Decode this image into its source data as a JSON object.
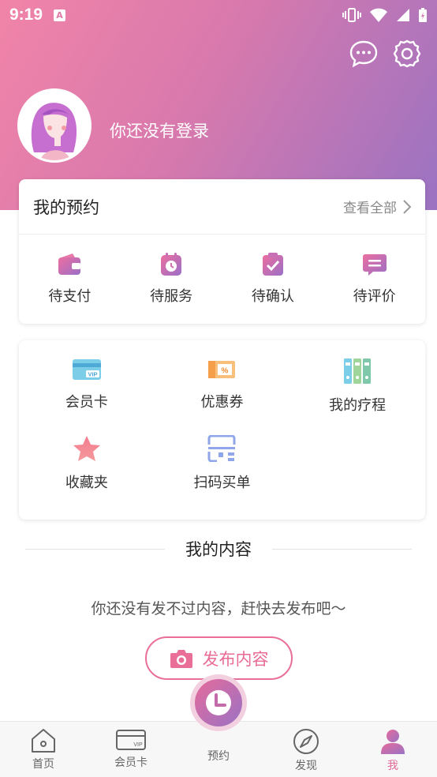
{
  "status_bar": {
    "time": "9:19",
    "indicator": "A"
  },
  "header": {
    "chat_icon": "chat-bubble-icon",
    "settings_icon": "gear-icon",
    "login_prompt": "你还没有登录"
  },
  "appointments": {
    "title": "我的预约",
    "view_all": "查看全部",
    "items": [
      {
        "label": "待支付",
        "icon": "wallet-icon"
      },
      {
        "label": "待服务",
        "icon": "clock-icon"
      },
      {
        "label": "待确认",
        "icon": "check-clipboard-icon"
      },
      {
        "label": "待评价",
        "icon": "comment-icon"
      }
    ]
  },
  "tools": {
    "items": [
      {
        "label": "会员卡",
        "icon": "vip-card-icon"
      },
      {
        "label": "优惠券",
        "icon": "coupon-icon"
      },
      {
        "label": "我的疗程",
        "icon": "binders-icon"
      },
      {
        "label": "收藏夹",
        "icon": "star-icon"
      },
      {
        "label": "扫码买单",
        "icon": "scan-icon"
      }
    ]
  },
  "content": {
    "title": "我的内容",
    "empty_text": "你还没有发不过内容，赶快去发布吧～",
    "publish_button": "发布内容"
  },
  "tabbar": {
    "tabs": [
      {
        "label": "首页",
        "icon": "home-icon"
      },
      {
        "label": "会员卡",
        "icon": "card-icon"
      },
      {
        "label": "预约",
        "icon": "clock-icon"
      },
      {
        "label": "发现",
        "icon": "compass-icon"
      },
      {
        "label": "我",
        "icon": "person-icon"
      }
    ],
    "active_tab": "我"
  },
  "colors": {
    "accent_pink": "#e86b94",
    "accent_purple": "#9a73c2",
    "header_gradient_start": "#f184a8",
    "header_gradient_end": "#9a73c2"
  }
}
